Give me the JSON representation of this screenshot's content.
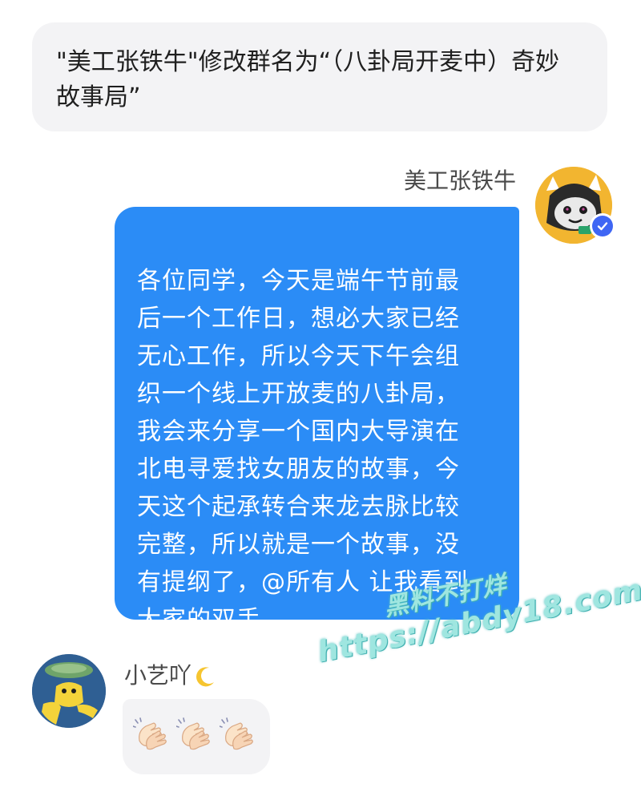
{
  "system_notice": {
    "text": "\"美工张铁牛\"修改群名为“（八卦局开麦中）奇妙故事局”"
  },
  "messages": {
    "right": {
      "sender": "美工张铁牛",
      "text": "各位同学，今天是端午节前最\n后一个工作日，想必大家已经\n无心工作，所以今天下午会组\n织一个线上开放麦的八卦局，\n我会来分享一个国内大导演在\n北电寻爱找女朋友的故事，今\n天这个起承转合来龙去脉比较\n完整，所以就是一个故事，没\n有提纲了，@所有人 让我看到\n大家的双手"
    },
    "left": {
      "sender": "小艺吖",
      "sender_emoji": "crescent-moon-icon",
      "content": [
        "clapping-hands-icon",
        "clapping-hands-icon",
        "clapping-hands-icon"
      ]
    }
  },
  "watermark": {
    "line1": "黑料不打烊",
    "line2": "https://abdy18.com"
  },
  "colors": {
    "bubble_blue": "#2b8cf6",
    "bubble_gray": "#f3f3f5",
    "verified": "#3f66f4",
    "watermark": "#9fe6e0"
  }
}
